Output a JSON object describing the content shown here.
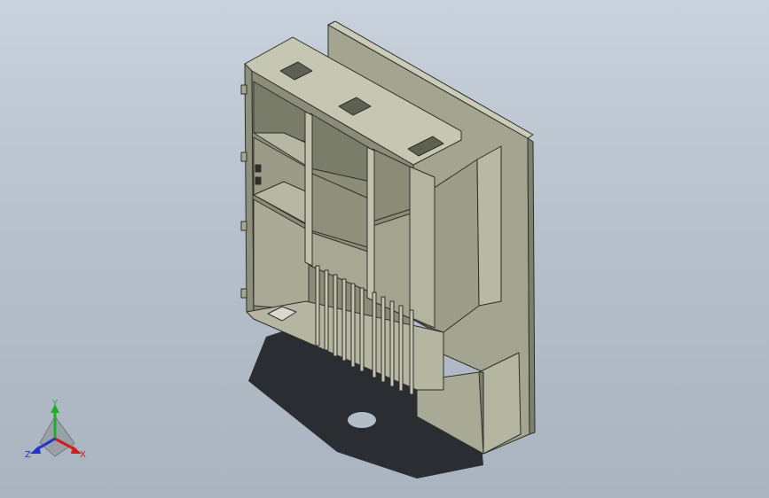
{
  "viewport": {
    "background_top": "#c9d2dc",
    "background_bottom": "#aab4c0"
  },
  "model": {
    "face_light": "#b9bba8",
    "face_mid": "#9fa18d",
    "face_dark": "#7c7e6c",
    "edge": "#2e2f29"
  },
  "triad": {
    "labels": {
      "x": "X",
      "y": "Y",
      "z": "Z"
    },
    "colors": {
      "x": "#d0201a",
      "y": "#1fae2a",
      "z": "#2233cc"
    }
  }
}
